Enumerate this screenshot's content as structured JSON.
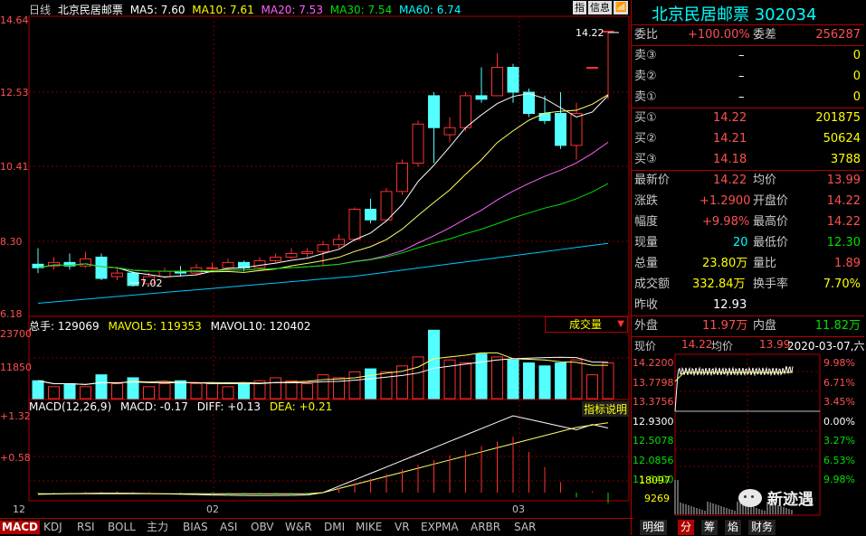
{
  "stock": {
    "name": "北京民居邮票",
    "code": "302034"
  },
  "chart_header": {
    "period": "日线",
    "name": "北京民居邮票",
    "ma5_label": "MA5: 7.60",
    "ma10_label": "MA10: 7.61",
    "ma20_label": "MA20: 7.53",
    "ma30_label": "MA30: 7.54",
    "ma60_label": "MA60: 6.74",
    "btn_icon1": "指",
    "btn_info": "信息",
    "btn_icon2": "📶"
  },
  "price_axis": [
    "14.64",
    "12.53",
    "10.41",
    "8.30",
    "6.18"
  ],
  "annotations": {
    "high": "14.22",
    "low": "7.02"
  },
  "volume_header": {
    "total": "总手: 129069",
    "mavol5": "MAVOL5: 119353",
    "mavol10": "MAVOL10: 120402",
    "selector": "成交量",
    "axis": [
      "23700",
      "11850"
    ]
  },
  "macd_header": {
    "label": "MACD(12,26,9)",
    "macd": "MACD: -0.17",
    "diff": "DIFF: +0.13",
    "dea": "DEA: +0.21",
    "help": "指标说明",
    "axis": [
      "+1.32",
      "+0.58"
    ]
  },
  "date_axis": [
    "12",
    "02",
    "03"
  ],
  "indicator_tabs": [
    "MACD",
    "KDJ",
    "RSI",
    "BOLL",
    "主力",
    "BIAS",
    "ASI",
    "OBV",
    "W&R",
    "DMI",
    "MIKE",
    "VR",
    "EXPMA",
    "ARBR",
    "SAR"
  ],
  "quote": {
    "weibi_label": "委比",
    "weibi": "+100.00%",
    "weicha_label": "委差",
    "weicha": "256287",
    "asks": [
      {
        "label": "卖③",
        "price": "–",
        "vol": "0"
      },
      {
        "label": "卖②",
        "price": "–",
        "vol": "0"
      },
      {
        "label": "卖①",
        "price": "–",
        "vol": "0"
      }
    ],
    "bids": [
      {
        "label": "买①",
        "price": "14.22",
        "vol": "201875"
      },
      {
        "label": "买②",
        "price": "14.21",
        "vol": "50624"
      },
      {
        "label": "买③",
        "price": "14.18",
        "vol": "3788"
      }
    ],
    "rows": [
      {
        "l1": "最新价",
        "v1": "14.22",
        "l2": "均价",
        "v2": "13.99"
      },
      {
        "l1": "涨跌",
        "v1": "+1.2900",
        "l2": "开盘价",
        "v2": "14.22"
      },
      {
        "l1": "幅度",
        "v1": "+9.98%",
        "l2": "最高价",
        "v2": "14.22"
      },
      {
        "l1": "现量",
        "v1": "20",
        "l2": "最低价",
        "v2": "12.30"
      },
      {
        "l1": "总量",
        "v1": "23.80万",
        "l2": "量比",
        "v2": "1.89"
      },
      {
        "l1": "成交额",
        "v1": "332.84万",
        "l2": "换手率",
        "v2": "7.70%"
      }
    ],
    "prev_label": "昨收",
    "prev": "12.93",
    "outer_label": "外盘",
    "outer": "11.97万",
    "inner_label": "内盘",
    "inner": "11.82万"
  },
  "intraday": {
    "now_label": "现价",
    "now": "14.22",
    "avg_label": "均价",
    "avg": "13.99",
    "date": "2020-03-07,六",
    "left_axis": [
      "14.2200",
      "13.7798",
      "13.3756",
      "12.9300",
      "12.5078",
      "12.0856",
      "11.6400"
    ],
    "right_axis": [
      "9.98%",
      "6.71%",
      "3.45%",
      "0.00%",
      "3.27%",
      "6.53%",
      "9.98%"
    ],
    "vol_axis": [
      "18097",
      "9269"
    ]
  },
  "bottom_tabs": [
    "明细",
    "分",
    "筹",
    "焰",
    "财务"
  ],
  "watermark": "新迹遇"
}
